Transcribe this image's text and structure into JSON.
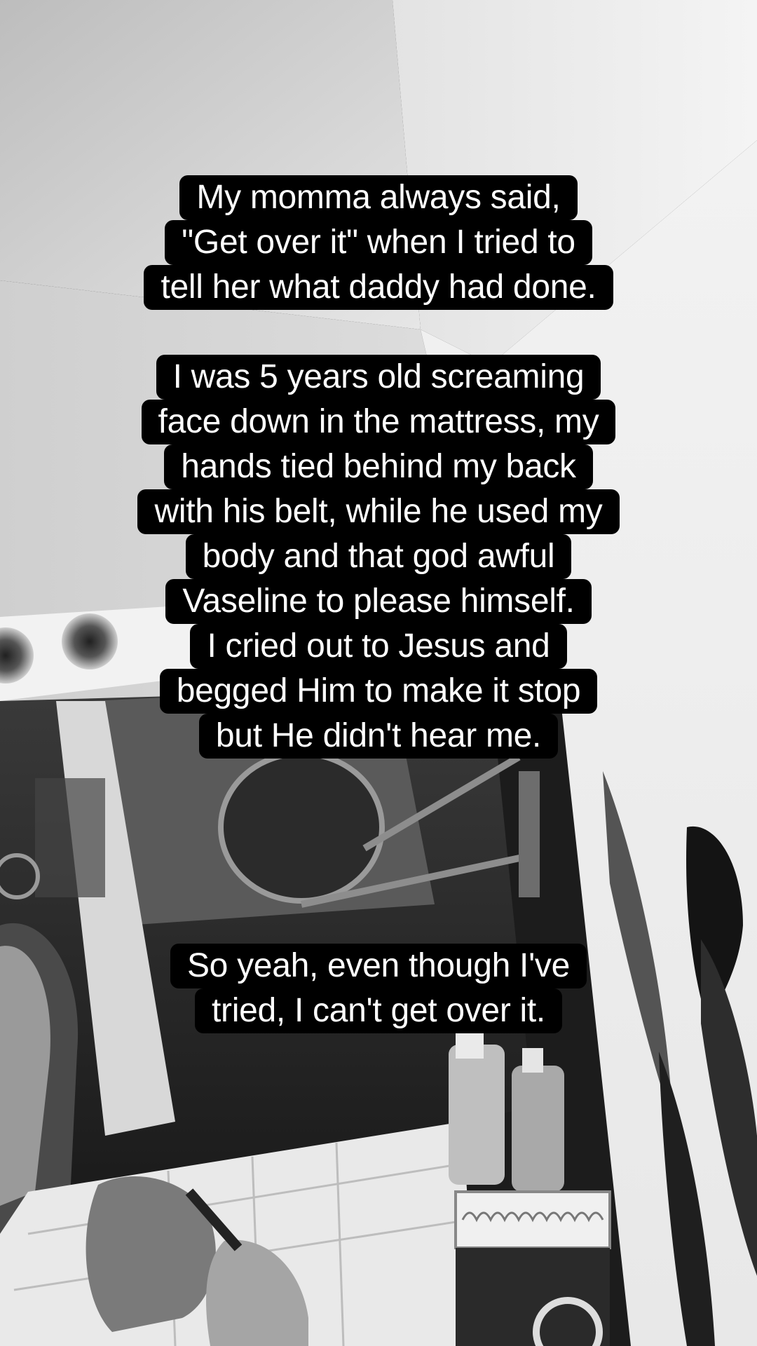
{
  "captions": [
    {
      "lines": [
        "My momma always said,",
        "\"Get over it\" when I tried to",
        "tell her what daddy had done."
      ]
    },
    {
      "lines": [
        "I was 5 years old screaming",
        "face down in the mattress, my",
        "hands tied behind my back",
        "with his belt, while he used my",
        "body and that god awful",
        "Vaseline to please himself.",
        "I cried out to Jesus and",
        "begged Him to make it stop",
        "but He didn't hear me."
      ]
    },
    {
      "lines": [
        "So yeah, even though I've",
        "tried, I can't get over it."
      ]
    }
  ]
}
